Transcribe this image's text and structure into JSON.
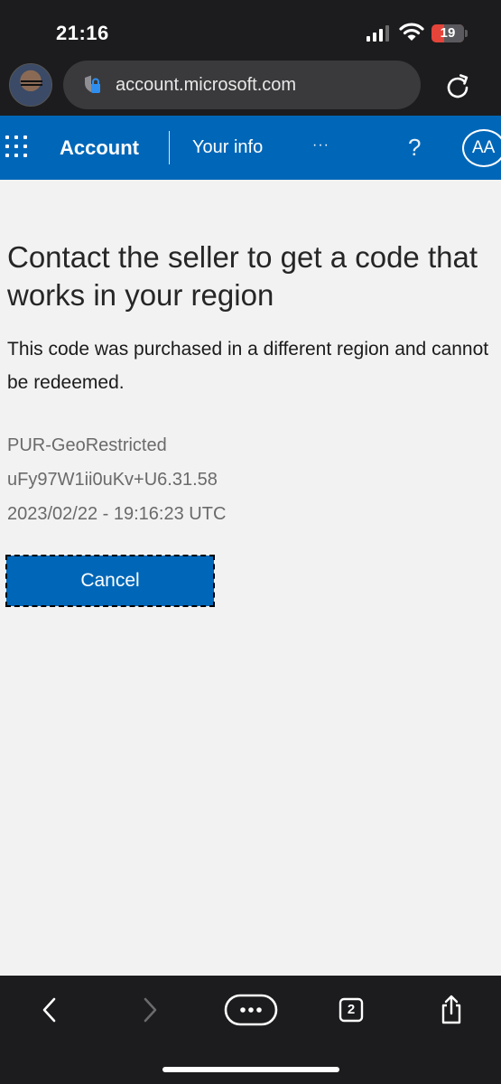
{
  "status_bar": {
    "time": "21:16",
    "battery": "19"
  },
  "browser": {
    "url": "account.microsoft.com",
    "tab_count": "2"
  },
  "header": {
    "brand": "Account",
    "nav_item": "Your info",
    "more": "···",
    "help": "?",
    "user_initials": "AA"
  },
  "content": {
    "heading": "Contact the seller to get a code that works in your region",
    "message": "This code was purchased in a different region and cannot be redeemed.",
    "details": {
      "error_code": "PUR-GeoRestricted",
      "correlation_id": "uFy97W1ii0uKv+U6.31.58",
      "timestamp": "2023/02/22 - 19:16:23 UTC"
    },
    "cancel_label": "Cancel"
  },
  "colors": {
    "brand_blue": "#0067b8",
    "dark_chrome": "#1c1c1e",
    "battery_low": "#e5443a"
  }
}
